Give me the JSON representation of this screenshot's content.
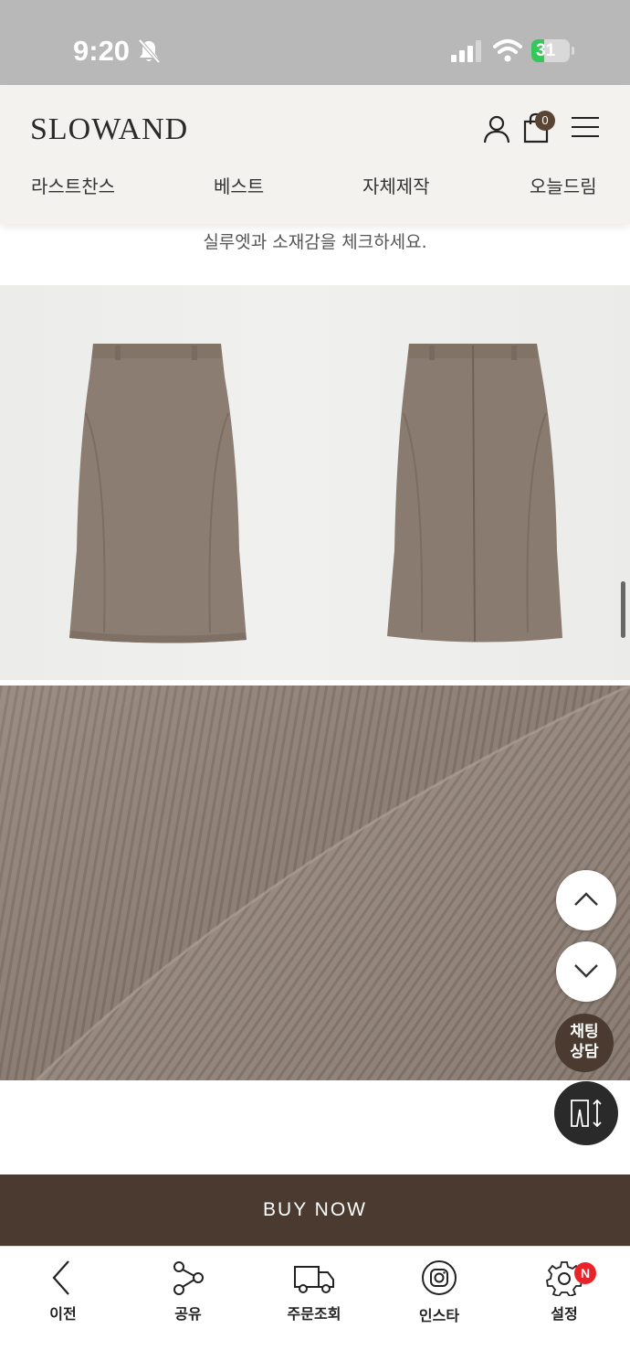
{
  "status_bar": {
    "time": "9:20",
    "battery": "31",
    "icons": [
      "bell-slash-icon",
      "signal-icon",
      "wifi-icon",
      "battery-charging-icon"
    ]
  },
  "header": {
    "logo": "SLOWAND",
    "cart_count": "0",
    "icons": [
      "user-icon",
      "shopping-bag-icon",
      "hamburger-menu-icon"
    ],
    "nav": [
      "라스트찬스",
      "베스트",
      "자체제작",
      "오늘드림"
    ]
  },
  "content": {
    "subtitle": "실루엣과 소재감을 체크하세요.",
    "product_photo": "skirt-front-back-photo",
    "fabric_photo": "fabric-texture-closeup"
  },
  "floating": {
    "scroll_up": "chevron-up-icon",
    "scroll_down": "chevron-down-icon",
    "chat_line1": "채팅",
    "chat_line2": "상담",
    "size": "size-chart-icon"
  },
  "buy_now": "BUY NOW",
  "toolbar": {
    "items": [
      {
        "label": "이전",
        "icon": "back-icon"
      },
      {
        "label": "공유",
        "icon": "share-icon"
      },
      {
        "label": "주문조회",
        "icon": "truck-icon"
      },
      {
        "label": "인스타",
        "icon": "instagram-icon"
      },
      {
        "label": "설정",
        "icon": "gear-icon"
      }
    ],
    "settings_badge": "N"
  },
  "colors": {
    "header_bg": "#f4f2ee",
    "accent_brown": "#4a3a2f",
    "fabric": "#8f7f74",
    "badge_red": "#e8232a"
  }
}
